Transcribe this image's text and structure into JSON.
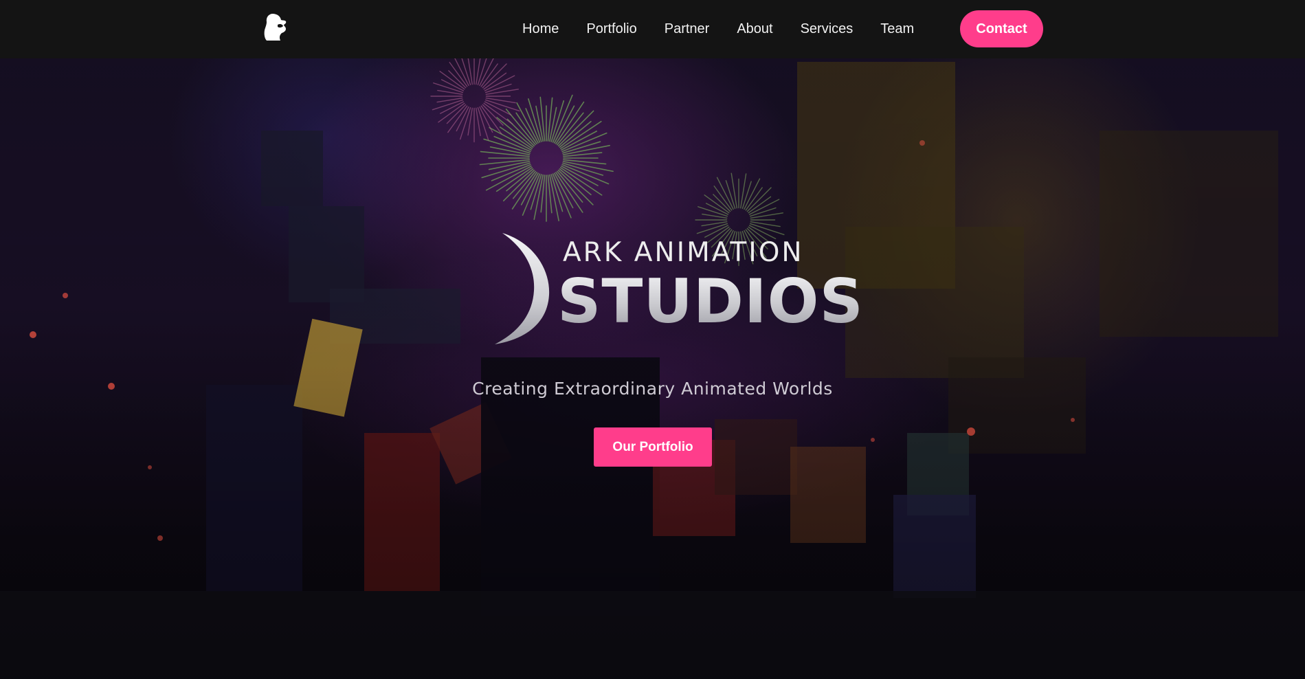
{
  "nav": {
    "logo_icon": "ark-head-logo",
    "links": [
      "Home",
      "Portfolio",
      "Partner",
      "About",
      "Services",
      "Team"
    ],
    "contact_label": "Contact"
  },
  "hero": {
    "brand_line1": "ARK ANIMATION",
    "brand_line2": "STUDIOS",
    "brand_mark": "crescent-moon-logo",
    "tagline": "Creating Extraordinary Animated Worlds",
    "cta_label": "Our Portfolio",
    "background": "fireworks-blocky-characters-scene"
  },
  "colors": {
    "accent": "#ff3d8b",
    "navbar": "#141414",
    "text": "#f2f2f2"
  }
}
